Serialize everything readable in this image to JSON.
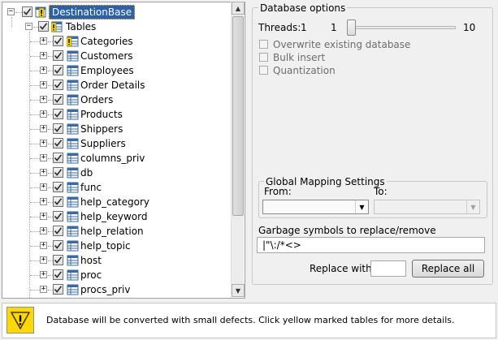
{
  "tree": {
    "root": {
      "label": "DestinationBase",
      "expander": "−"
    },
    "tables_node": {
      "label": "Tables",
      "expander": "−"
    },
    "items": [
      {
        "label": "Categories",
        "expander": "+",
        "warning": true
      },
      {
        "label": "Customers",
        "expander": "+",
        "warning": false
      },
      {
        "label": "Employees",
        "expander": "+",
        "warning": false
      },
      {
        "label": "Order Details",
        "expander": "+",
        "warning": false
      },
      {
        "label": "Orders",
        "expander": "+",
        "warning": false
      },
      {
        "label": "Products",
        "expander": "+",
        "warning": false
      },
      {
        "label": "Shippers",
        "expander": "+",
        "warning": false
      },
      {
        "label": "Suppliers",
        "expander": "+",
        "warning": false
      },
      {
        "label": "columns_priv",
        "expander": "+",
        "warning": false
      },
      {
        "label": "db",
        "expander": "+",
        "warning": false
      },
      {
        "label": "func",
        "expander": "+",
        "warning": false
      },
      {
        "label": "help_category",
        "expander": "+",
        "warning": false
      },
      {
        "label": "help_keyword",
        "expander": "+",
        "warning": false
      },
      {
        "label": "help_relation",
        "expander": "+",
        "warning": false
      },
      {
        "label": "help_topic",
        "expander": "+",
        "warning": false
      },
      {
        "label": "host",
        "expander": "+",
        "warning": false
      },
      {
        "label": "proc",
        "expander": "+",
        "warning": false
      },
      {
        "label": "procs_priv",
        "expander": "+",
        "warning": false
      }
    ]
  },
  "scrollbar": {
    "up": "▲",
    "down": "▼"
  },
  "options": {
    "title": "Database options",
    "threads_label": "Threads:",
    "threads_value": "1",
    "slider_min": "1",
    "slider_max": "10",
    "slider_level": 0,
    "overwrite_label": "Overwrite existing database",
    "bulk_label": "Bulk insert",
    "quant_label": "Quantization",
    "mapping_title": "Global Mapping Settings",
    "from_label": "From:",
    "to_label": "To:",
    "from_value": "",
    "to_value": "",
    "dropdown_arrow": "▼",
    "garbage_label": "Garbage symbols to replace/remove",
    "garbage_value": "|\"\\:/*<>",
    "replace_with_label": "Replace with:",
    "replace_with_value": "",
    "replace_all_label": "Replace all"
  },
  "status": {
    "message": "Database will be converted with small defects. Click yellow marked tables for more details.",
    "icon": "warning-icon",
    "color": "#ffd800"
  },
  "colors": {
    "selection": "#2b5fb0",
    "warning": "#ffd800"
  }
}
